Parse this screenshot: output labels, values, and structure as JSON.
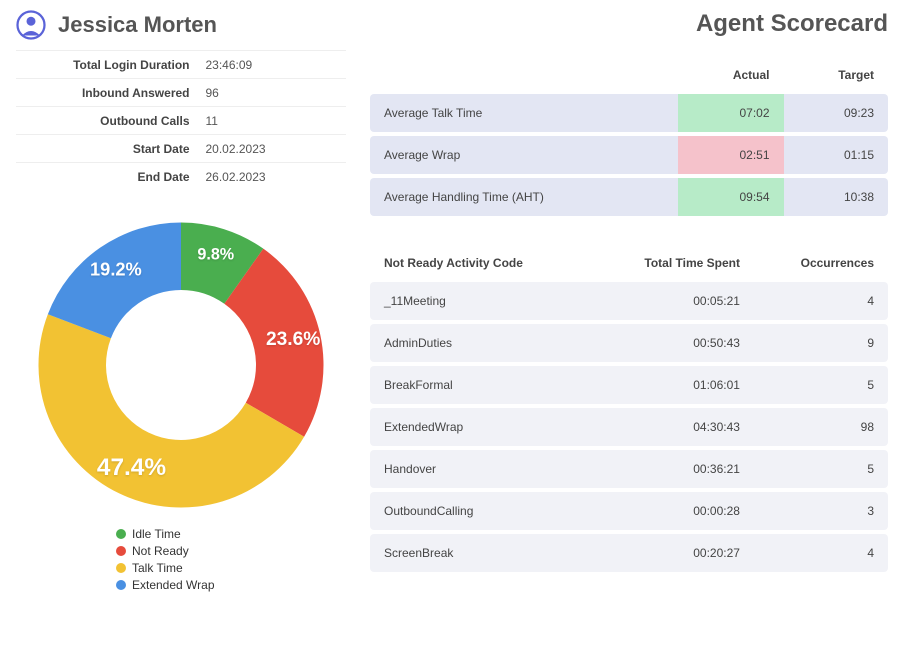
{
  "agent": {
    "name": "Jessica Morten"
  },
  "page_title": "Agent Scorecard",
  "summary": {
    "rows": [
      {
        "label": "Total Login Duration",
        "value": "23:46:09"
      },
      {
        "label": "Inbound Answered",
        "value": "96"
      },
      {
        "label": "Outbound Calls",
        "value": "11"
      },
      {
        "label": "Start Date",
        "value": "20.02.2023"
      },
      {
        "label": "End Date",
        "value": "26.02.2023"
      }
    ]
  },
  "chart_data": {
    "type": "pie",
    "title": "",
    "series": [
      {
        "name": "Idle Time",
        "value": 9.8,
        "color": "#4aae4f",
        "label": "9.8%"
      },
      {
        "name": "Not Ready",
        "value": 23.6,
        "color": "#e64b3c",
        "label": "23.6%"
      },
      {
        "name": "Talk Time",
        "value": 47.4,
        "color": "#f2c233",
        "label": "47.4%"
      },
      {
        "name": "Extended Wrap",
        "value": 19.2,
        "color": "#4a90e2",
        "label": "19.2%"
      }
    ]
  },
  "metrics": {
    "headers": {
      "metric": "",
      "actual": "Actual",
      "target": "Target"
    },
    "rows": [
      {
        "label": "Average Talk Time",
        "actual": "07:02",
        "target": "09:23",
        "status": "green"
      },
      {
        "label": "Average Wrap",
        "actual": "02:51",
        "target": "01:15",
        "status": "red"
      },
      {
        "label": "Average Handling Time (AHT)",
        "actual": "09:54",
        "target": "10:38",
        "status": "green"
      }
    ]
  },
  "activity": {
    "headers": {
      "code": "Not Ready Activity Code",
      "time": "Total Time Spent",
      "occ": "Occurrences"
    },
    "rows": [
      {
        "code": "_11Meeting",
        "time": "00:05:21",
        "occ": "4"
      },
      {
        "code": "AdminDuties",
        "time": "00:50:43",
        "occ": "9"
      },
      {
        "code": "BreakFormal",
        "time": "01:06:01",
        "occ": "5"
      },
      {
        "code": "ExtendedWrap",
        "time": "04:30:43",
        "occ": "98"
      },
      {
        "code": "Handover",
        "time": "00:36:21",
        "occ": "5"
      },
      {
        "code": "OutboundCalling",
        "time": "00:00:28",
        "occ": "3"
      },
      {
        "code": "ScreenBreak",
        "time": "00:20:27",
        "occ": "4"
      }
    ]
  }
}
